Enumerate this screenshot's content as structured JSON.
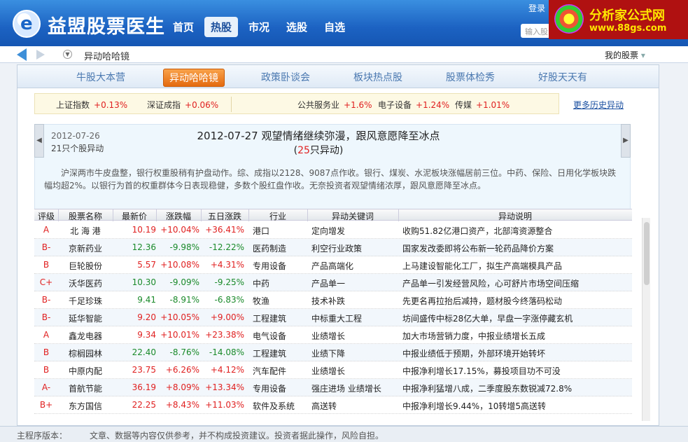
{
  "app": {
    "title": "益盟股票医生",
    "logo_icon": "logo-e-icon"
  },
  "topnav": [
    "首页",
    "热股",
    "市况",
    "选股",
    "自选"
  ],
  "topnav_active": 1,
  "header_right": {
    "login": "登录",
    "search_placeholder": "输入股"
  },
  "brand": {
    "line1": "分析家公式网",
    "line2": "www.88gs.com"
  },
  "crumbbar": {
    "crumb": "异动哈哈镜",
    "mystocks": "我的股票"
  },
  "subtabs": [
    "牛股大本营",
    "异动哈哈镜",
    "政策卧谈会",
    "板块热点股",
    "股票体检秀",
    "好股天天有"
  ],
  "subtabs_active": 1,
  "indices": [
    {
      "label": "上证指数",
      "value": "+0.13%"
    },
    {
      "label": "深证成指",
      "value": "+0.06%"
    },
    {
      "label": "公共服务业",
      "value": "+1.6%"
    },
    {
      "label": "电子设备",
      "value": "+1.24%"
    },
    {
      "label": "传媒",
      "value": "+1.01%"
    }
  ],
  "more_link": "更多历史异动",
  "summary": {
    "prev_date": "2012-07-26",
    "prev_count": "21只个股异动",
    "headline": "2012-07-27 观望情绪继续弥漫，跟风意愿降至冰点",
    "headline_count": "25",
    "headline_count_suffix": "只异动)",
    "headline_prefix": "(",
    "text": "沪深两市牛皮盘整，银行权重股稍有护盘动作。综、成指以2128、9087点作收。银行、煤炭、水泥板块涨幅居前三位。中药、保险、日用化学板块跌幅均超2%。以银行为首的权重群体今日表现稳健，多数个股红盘作收。无奈投资者观望情绪浓厚，跟风意愿降至冰点。"
  },
  "table": {
    "headers": [
      "评级",
      "股票名称",
      "最新价",
      "涨跌幅",
      "五日涨跌",
      "行业",
      "异动关键词",
      "异动说明"
    ],
    "rows": [
      {
        "rating": "A",
        "name": "北 海 港",
        "price": "10.19",
        "pct": "+10.04%",
        "five": "+36.41%",
        "industry": "港口",
        "keyword": "定向增发",
        "desc": "收购51.82亿港口资产，北部湾资源整合"
      },
      {
        "rating": "B-",
        "name": "京新药业",
        "price": "12.36",
        "pct": "-9.98%",
        "five": "-12.22%",
        "industry": "医药制造",
        "keyword": "利空行业政策",
        "desc": "国家发改委即将公布新一轮药品降价方案"
      },
      {
        "rating": "B",
        "name": "巨轮股份",
        "price": "5.57",
        "pct": "+10.08%",
        "five": "+4.31%",
        "industry": "专用设备",
        "keyword": "产品高端化",
        "desc": "上马建设智能化工厂，拟生产高端模具产品"
      },
      {
        "rating": "C+",
        "name": "沃华医药",
        "price": "10.30",
        "pct": "-9.09%",
        "five": "-9.25%",
        "industry": "中药",
        "keyword": "产品单一",
        "desc": "产品单一引发经营风险，心可舒片市场空间压缩"
      },
      {
        "rating": "B-",
        "name": "千足珍珠",
        "price": "9.41",
        "pct": "-8.91%",
        "five": "-6.83%",
        "industry": "牧渔",
        "keyword": "技术补跌",
        "desc": "先更名再拉抬后减持，题材股今终落码松动"
      },
      {
        "rating": "B-",
        "name": "延华智能",
        "price": "9.20",
        "pct": "+10.05%",
        "five": "+9.00%",
        "industry": "工程建筑",
        "keyword": "中标重大工程",
        "desc": "坊间盛传中标28亿大单，早盘一字涨停藏玄机"
      },
      {
        "rating": "A",
        "name": "鑫龙电器",
        "price": "9.34",
        "pct": "+10.01%",
        "five": "+23.38%",
        "industry": "电气设备",
        "keyword": "业绩增长",
        "desc": "加大市场营销力度，中报业绩增长五成"
      },
      {
        "rating": "B",
        "name": "棕榈园林",
        "price": "22.40",
        "pct": "-8.76%",
        "five": "-14.08%",
        "industry": "工程建筑",
        "keyword": "业绩下降",
        "desc": "中报业绩低于预期，外部环境开始转坏"
      },
      {
        "rating": "B",
        "name": "中原内配",
        "price": "23.75",
        "pct": "+6.26%",
        "five": "+4.12%",
        "industry": "汽车配件",
        "keyword": "业绩增长",
        "desc": "中报净利增长17.15%，募投项目功不可没"
      },
      {
        "rating": "A-",
        "name": "首航节能",
        "price": "36.19",
        "pct": "+8.09%",
        "five": "+13.34%",
        "industry": "专用设备",
        "keyword": "强庄进场 业绩增长",
        "desc": "中报净利猛增八成，二季度股东数锐减72.8%"
      },
      {
        "rating": "B+",
        "name": "东方国信",
        "price": "22.25",
        "pct": "+8.43%",
        "five": "+11.03%",
        "industry": "软件及系统",
        "keyword": "高送转",
        "desc": "中报净利增长9.44%，10转增5高送转"
      }
    ]
  },
  "footer": {
    "version_label": "主程序版本：",
    "disclaimer": "文章、数据等内容仅供参考，并不构成投资建议。投资者据此操作，风险自担。"
  },
  "colors": {
    "up": "#e02020",
    "down": "#1a8a2a",
    "header_blue": "#1c62c2",
    "active_tab_orange": "#e46a0f"
  }
}
